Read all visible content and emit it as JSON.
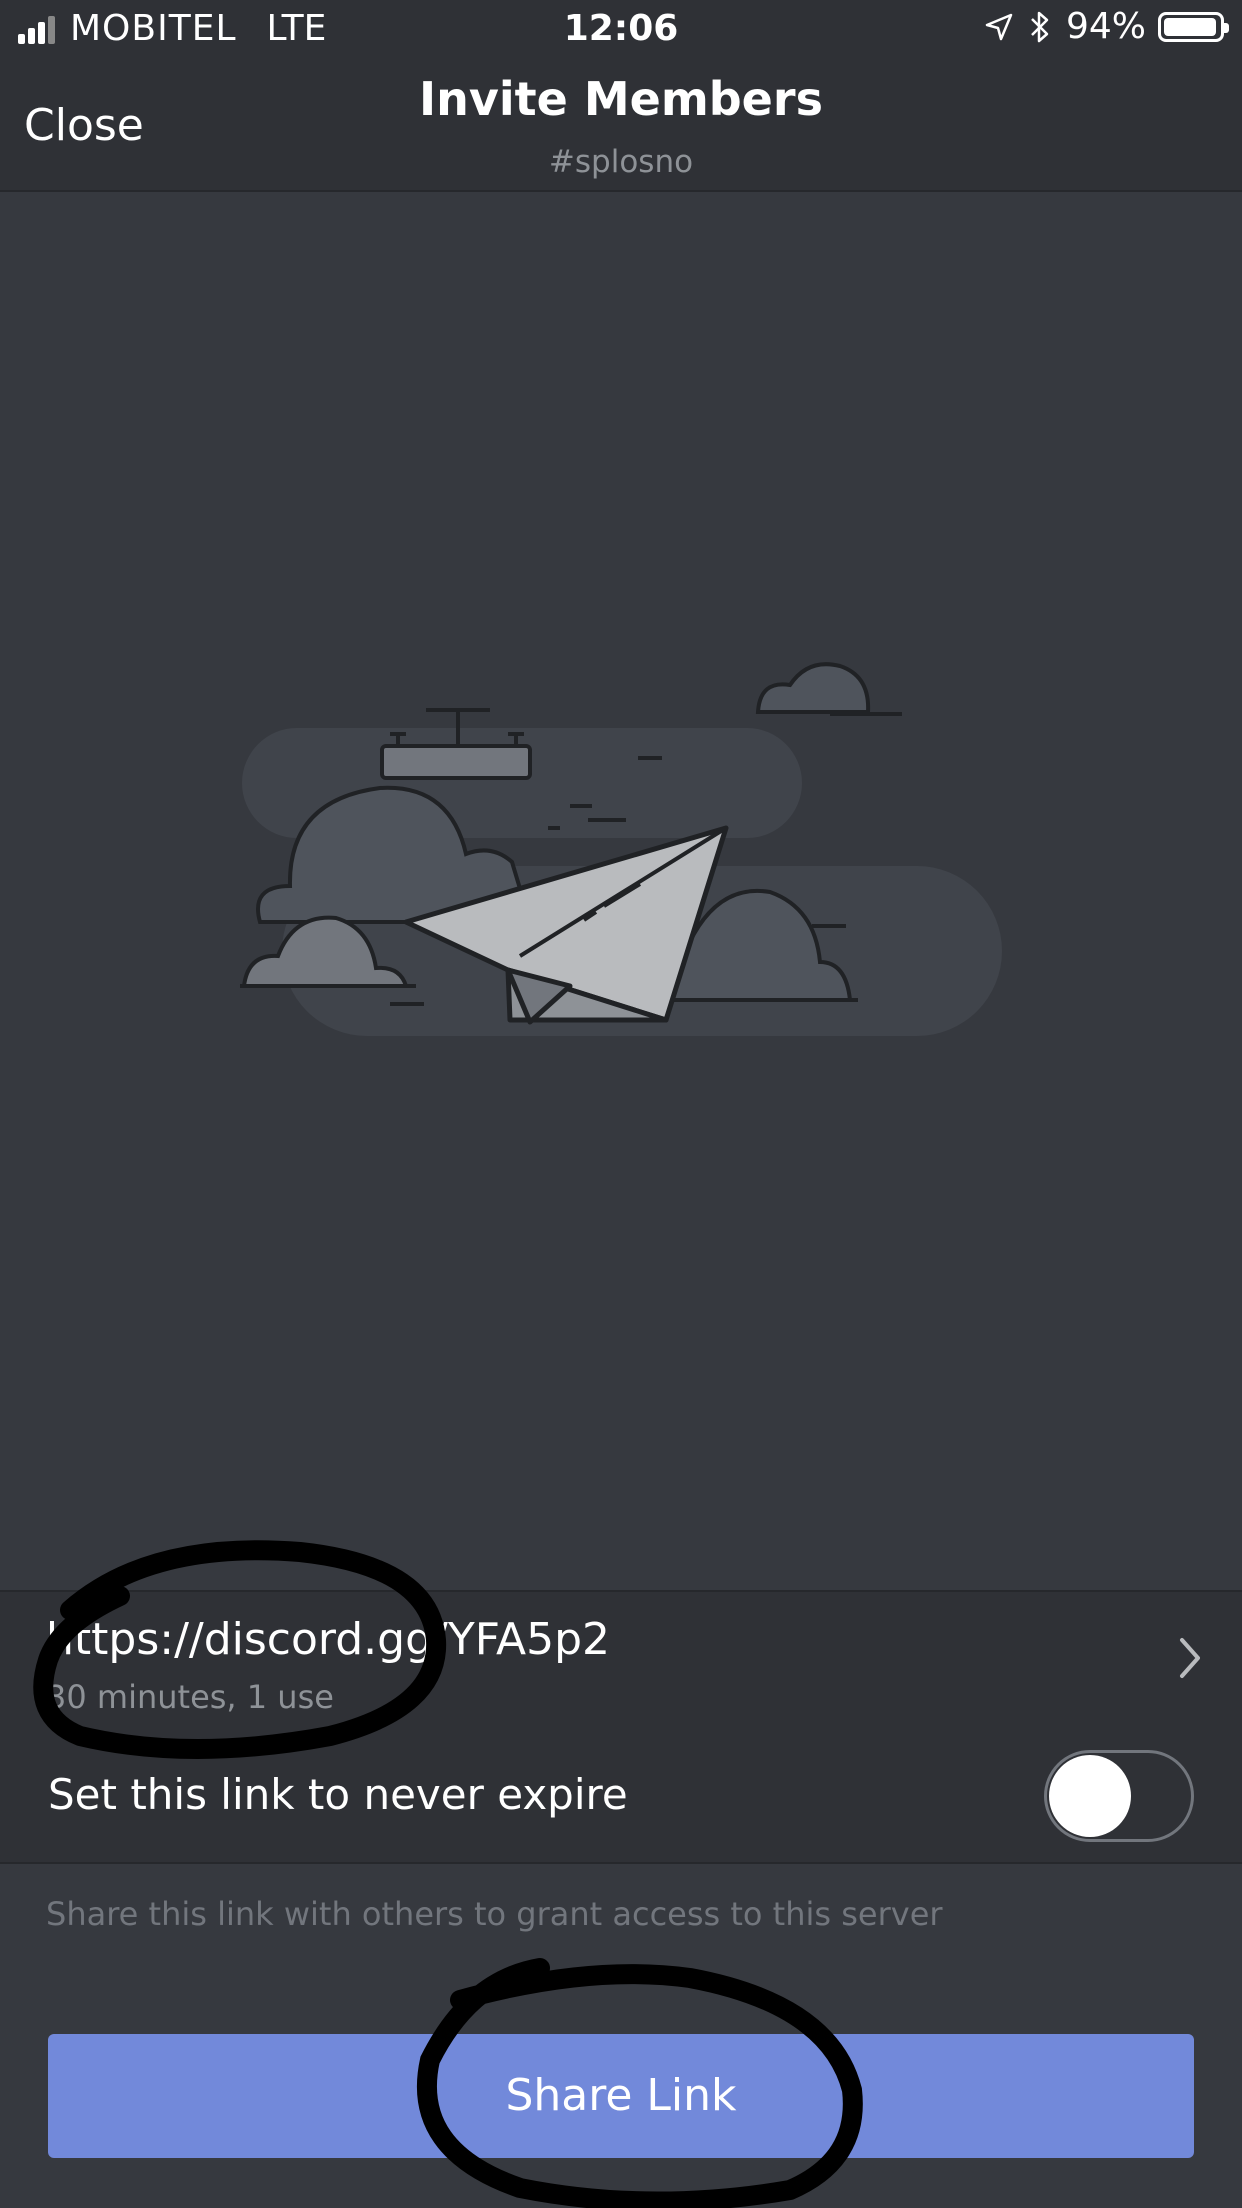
{
  "status_bar": {
    "carrier": "MOBITEL",
    "network": "LTE",
    "time": "12:06",
    "battery_percent": "94%",
    "battery_level": 0.94,
    "signal_bars_filled": 3,
    "signal_bars_total": 4
  },
  "header": {
    "close_label": "Close",
    "title": "Invite Members",
    "channel": "#splosno"
  },
  "invite": {
    "url": "https://discord.gg/YFA5p2",
    "meta": "30 minutes, 1 use"
  },
  "expire_setting": {
    "label": "Set this link to never expire",
    "enabled": false
  },
  "hint": "Share this link with others to grant access to this server",
  "share_button": "Share Link",
  "colors": {
    "background": "#36393f",
    "panel": "#2f3136",
    "accent": "#7289da",
    "muted_text": "#8e9297"
  }
}
